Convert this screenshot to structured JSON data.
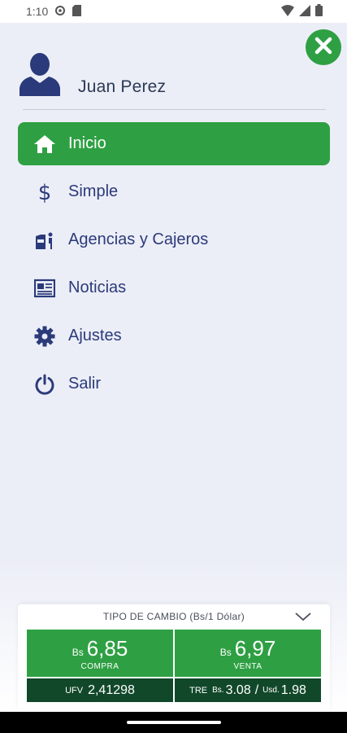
{
  "status_bar": {
    "time": "1:10"
  },
  "profile": {
    "user_name": "Juan Perez"
  },
  "menu": {
    "items": [
      {
        "label": "Inicio",
        "icon": "home-icon",
        "active": true
      },
      {
        "label": "Simple",
        "icon": "dollar-icon"
      },
      {
        "label": "Agencias y Cajeros",
        "icon": "atm-icon"
      },
      {
        "label": "Noticias",
        "icon": "newspaper-icon"
      },
      {
        "label": "Ajustes",
        "icon": "gear-icon"
      },
      {
        "label": "Salir",
        "icon": "power-icon"
      }
    ]
  },
  "exchange": {
    "header": "TIPO DE CAMBIO (Bs/1 Dólar)",
    "buy": {
      "currency": "Bs",
      "value": "6,85",
      "label": "COMPRA"
    },
    "sell": {
      "currency": "Bs",
      "value": "6,97",
      "label": "VENTA"
    },
    "ufv": {
      "tag": "UFV",
      "value": "2,41298"
    },
    "tre": {
      "tag": "TRE",
      "bs_label": "Bs.",
      "bs_value": "3.08",
      "sep": "/",
      "usd_label": "Usd.",
      "usd_value": "1.98"
    }
  },
  "colors": {
    "accent_green": "#2ea043",
    "dark_green": "#12482a",
    "navy_text": "#2b3a7a",
    "drawer_bg": "#eceef7"
  }
}
